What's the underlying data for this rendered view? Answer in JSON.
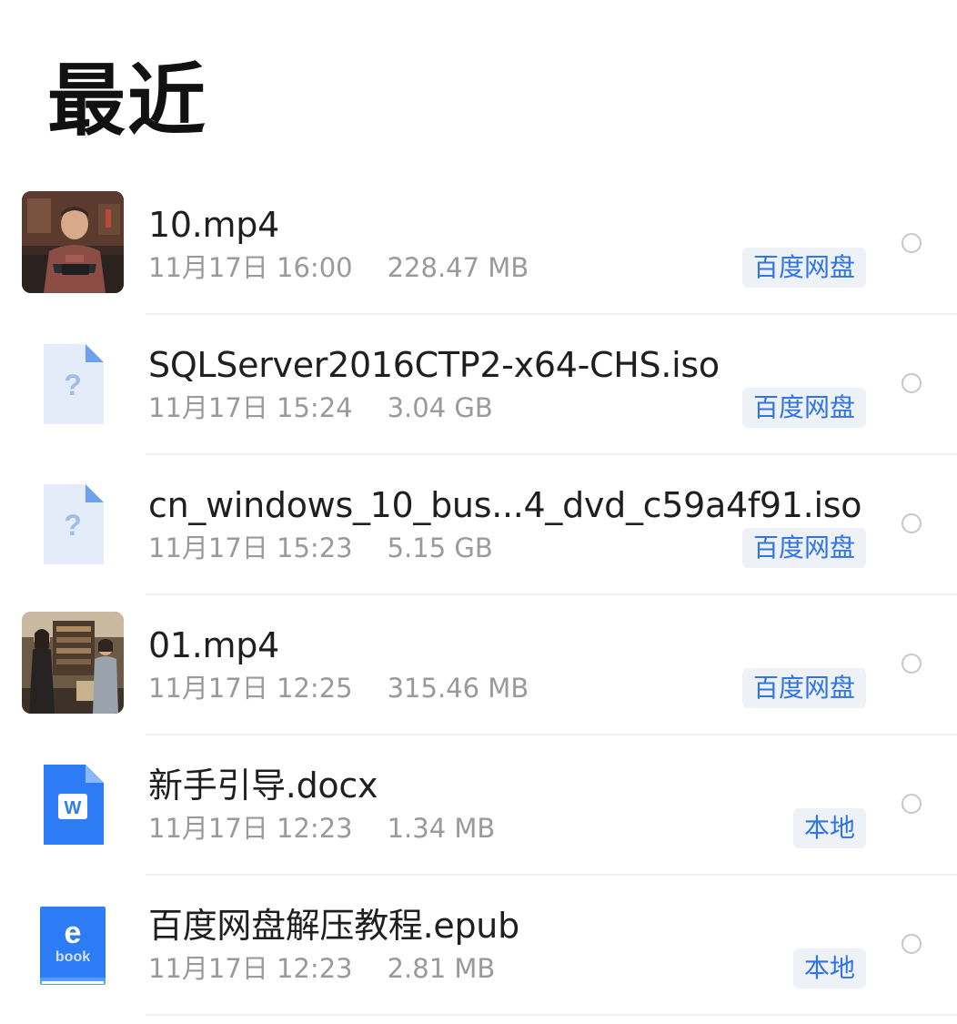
{
  "header": {
    "title": "最近"
  },
  "colors": {
    "accent": "#2f74e8",
    "badge_bg": "#eef1f6",
    "meta_text": "#9a9a9a",
    "unknown_icon": "#e3ecf8",
    "word_icon": "#2d7cf6",
    "ebook_icon": "#2d7cf6"
  },
  "files": [
    {
      "name": "10.mp4",
      "date": "11月17日 16:00",
      "size": "228.47 MB",
      "source": "百度网盘",
      "icon": "video-thumbnail"
    },
    {
      "name": "SQLServer2016CTP2-x64-CHS.iso",
      "date": "11月17日 15:24",
      "size": "3.04 GB",
      "source": "百度网盘",
      "icon": "unknown-file-icon",
      "icon_glyph": "?"
    },
    {
      "name": "cn_windows_10_bus...4_dvd_c59a4f91.iso",
      "date": "11月17日 15:23",
      "size": "5.15 GB",
      "source": "百度网盘",
      "icon": "unknown-file-icon",
      "icon_glyph": "?"
    },
    {
      "name": "01.mp4",
      "date": "11月17日 12:25",
      "size": "315.46 MB",
      "source": "百度网盘",
      "icon": "video-thumbnail"
    },
    {
      "name": "新手引导.docx",
      "date": "11月17日 12:23",
      "size": "1.34 MB",
      "source": "本地",
      "icon": "word-document-icon",
      "icon_glyph": "W"
    },
    {
      "name": "百度网盘解压教程.epub",
      "date": "11月17日 12:23",
      "size": "2.81 MB",
      "source": "本地",
      "icon": "ebook-icon",
      "icon_glyph": "e",
      "icon_caption": "book"
    }
  ]
}
